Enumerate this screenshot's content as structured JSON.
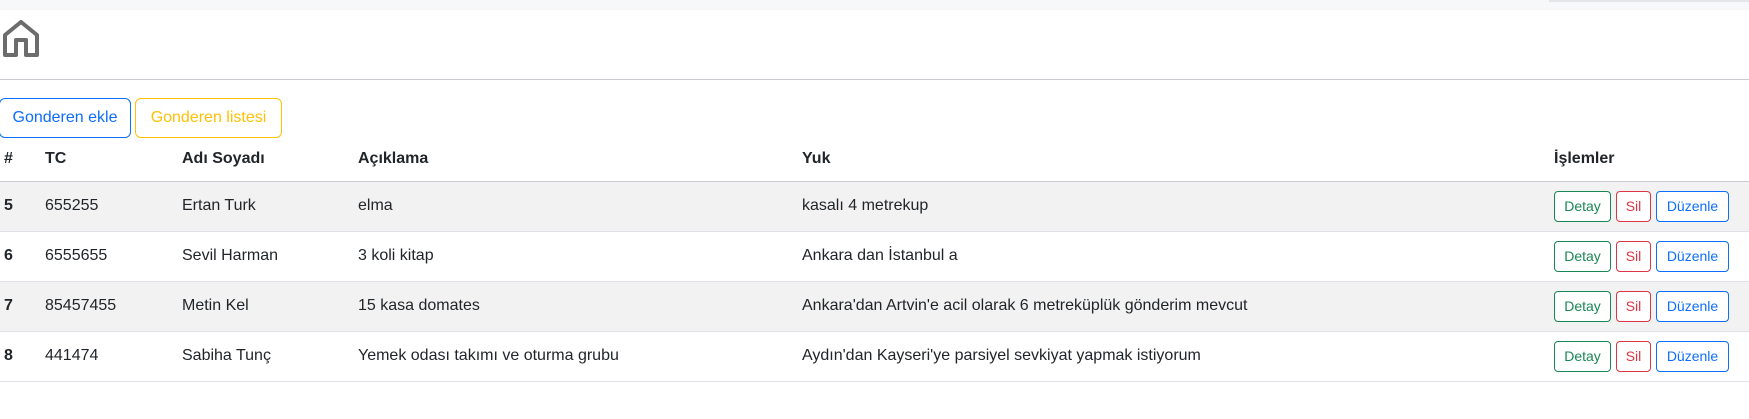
{
  "nav": {
    "home_icon": "home-icon"
  },
  "actions": {
    "add_label": "Gonderen ekle",
    "list_label": "Gonderen listesi"
  },
  "table": {
    "headers": [
      "#",
      "TC",
      "Adı Soyadı",
      "Açıklama",
      "Yuk",
      "İşlemler"
    ],
    "rows": [
      {
        "id": "5",
        "tc": "655255",
        "name": "Ertan Turk",
        "description": "elma",
        "load": "kasalı 4 metrekup"
      },
      {
        "id": "6",
        "tc": "6555655",
        "name": "Sevil Harman",
        "description": "3 koli kitap",
        "load": "Ankara dan İstanbul a"
      },
      {
        "id": "7",
        "tc": "85457455",
        "name": "Metin Kel",
        "description": "15 kasa domates",
        "load": "Ankara'dan Artvin'e acil olarak 6 metreküplük gönderim mevcut"
      },
      {
        "id": "8",
        "tc": "441474",
        "name": "Sabiha Tunç",
        "description": "Yemek odası takımı ve oturma grubu",
        "load": "Aydın'dan Kayseri'ye parsiyel sevkiyat yapmak istiyorum"
      }
    ],
    "row_actions": {
      "detail": "Detay",
      "delete": "Sil",
      "edit": "Düzenle"
    }
  },
  "colors": {
    "primary": "#0d6efd",
    "warning": "#ffc107",
    "success": "#198754",
    "danger": "#dc3545",
    "stripe": "#f2f2f2"
  }
}
